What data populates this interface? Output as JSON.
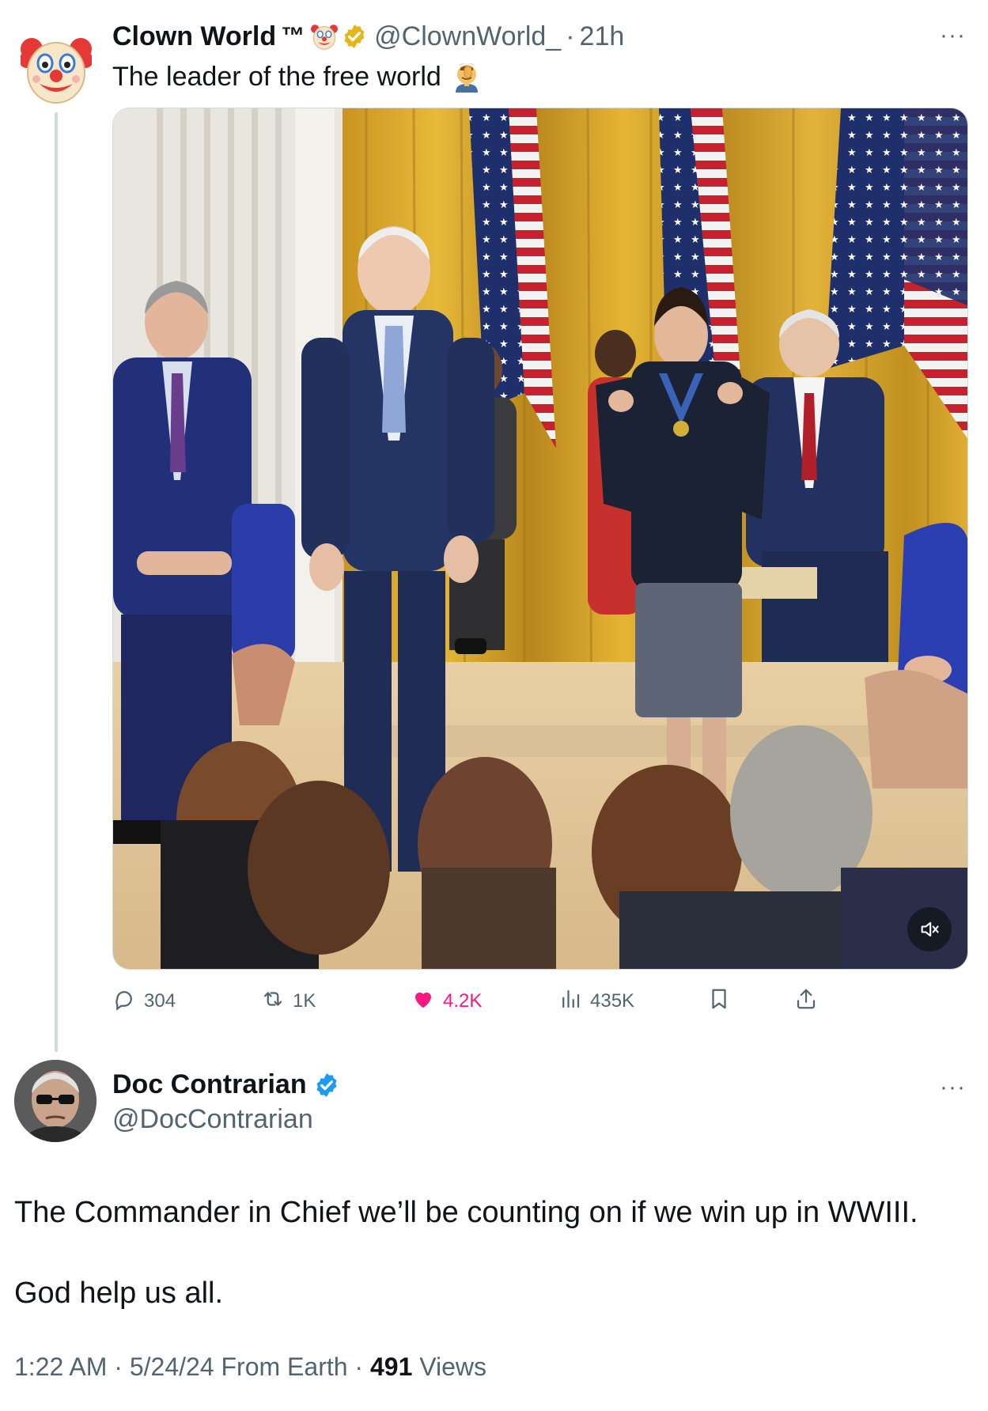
{
  "parent_tweet": {
    "display_name": "Clown World",
    "trademark": "™",
    "name_emoji_icon": "clown-face-icon",
    "handle": "@ClownWorld_",
    "separator": "·",
    "time": "21h",
    "text": "The leader of the free world",
    "text_emoji_icon": "facepalm-icon",
    "more_label": "···",
    "media": {
      "kind": "video",
      "muted": true,
      "mute_icon": "volume-muted-icon"
    },
    "stats": {
      "replies": "304",
      "reposts": "1K",
      "likes": "4.2K",
      "views": "435K"
    },
    "liked": true,
    "like_color": "#f91880"
  },
  "reply_tweet": {
    "display_name": "Doc Contrarian",
    "handle": "@DocContrarian",
    "verified_color": "#1d9bf0",
    "more_label": "···",
    "body": [
      "The Commander in Chief we’ll be counting on if we win up in WWIII.",
      "God help us all."
    ],
    "time": "1:22 AM",
    "date": "5/24/24",
    "source": "From Earth",
    "separator": "·",
    "views_count": "491",
    "views_label": "Views"
  },
  "colors": {
    "text_primary": "#0f1419",
    "text_secondary": "#536471",
    "verified_gold": "#e2b719",
    "border": "#cfd9de"
  }
}
